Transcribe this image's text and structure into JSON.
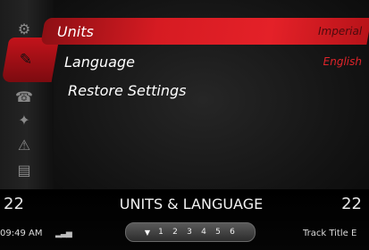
{
  "menu": {
    "items": [
      {
        "label": "Units",
        "value": "Imperial"
      },
      {
        "label": "Language",
        "value": "English"
      },
      {
        "label": "Restore Settings"
      }
    ]
  },
  "status": {
    "temp_left": "22",
    "temp_right": "22",
    "title": "UNITS & LANGUAGE",
    "clock": "09:49 AM",
    "track_title": "Track Title E"
  },
  "pager": {
    "pages": [
      "1",
      "2",
      "3",
      "4",
      "5",
      "6"
    ]
  },
  "colors": {
    "accent": "#d61b22",
    "background": "#121212"
  },
  "icons": {
    "strip": [
      "gear-icon",
      "chat-icon",
      "phone-icon",
      "tool-icon",
      "warning-icon",
      "fuel-icon"
    ],
    "pager_arrow": "down-arrow-icon",
    "signal": "signal-bars-icon"
  }
}
